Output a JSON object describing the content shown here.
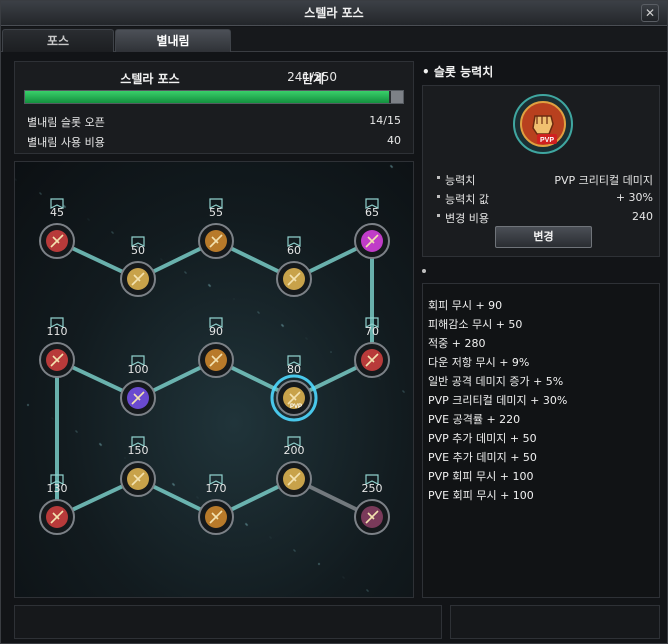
{
  "window": {
    "title": "스텔라 포스",
    "close_glyph": "✕"
  },
  "tabs": [
    {
      "label": "포스",
      "active": false
    },
    {
      "label": "별내림",
      "active": true
    }
  ],
  "info": {
    "title": "스텔라 포스",
    "progress_text": "241/250",
    "unit": "단계",
    "progress_fraction": 0.964,
    "rows": [
      {
        "label": "별내림 슬롯 오픈",
        "value": "14/15"
      },
      {
        "label": "별내림 사용 비용",
        "value": "40"
      }
    ]
  },
  "tree": {
    "nodes": [
      {
        "level": "45",
        "color": "#b83a3a",
        "pvp": false
      },
      {
        "level": "50",
        "color": "#c8a24a",
        "pvp": false
      },
      {
        "level": "55",
        "color": "#b87a2a",
        "pvp": false
      },
      {
        "level": "60",
        "color": "#c8a24a",
        "pvp": false
      },
      {
        "level": "65",
        "color": "#c03cc8",
        "pvp": false
      },
      {
        "level": "110",
        "color": "#b83a3a",
        "pvp": false
      },
      {
        "level": "100",
        "color": "#6a4ad0",
        "pvp": false
      },
      {
        "level": "90",
        "color": "#b87a2a",
        "pvp": false
      },
      {
        "level": "80",
        "color": "#c8a24a",
        "pvp": true
      },
      {
        "level": "70",
        "color": "#b83a3a",
        "pvp": false
      },
      {
        "level": "130",
        "color": "#b83a3a",
        "pvp": false
      },
      {
        "level": "150",
        "color": "#c8a24a",
        "pvp": false
      },
      {
        "level": "170",
        "color": "#b87a2a",
        "pvp": false
      },
      {
        "level": "200",
        "color": "#c8a24a",
        "pvp": false
      },
      {
        "level": "250",
        "color": "#7a3a5a",
        "pvp": false
      }
    ],
    "pvp_badge": "PVP"
  },
  "slot": {
    "header": "슬롯 능력치",
    "icon_badge": "PVP",
    "rows": [
      {
        "label": "능력치",
        "value": "PVP 크리티컬 데미지"
      },
      {
        "label": "능력치 값",
        "value": "+ 30%"
      },
      {
        "label": "변경 비용",
        "value": "240"
      }
    ],
    "change_button": "변경"
  },
  "stats": [
    "회피 무시 + 90",
    "피해감소 무시 + 50",
    "적중 + 280",
    "다운 저항 무시 + 9%",
    "일반 공격 데미지 증가 + 5%",
    "PVP 크리티컬 데미지 + 30%",
    "PVE 공격률 + 220",
    "PVP 추가 데미지 + 50",
    "PVE 추가 데미지 + 50",
    "PVP 회피 무시 + 100",
    "PVE 회피 무시 + 100"
  ]
}
